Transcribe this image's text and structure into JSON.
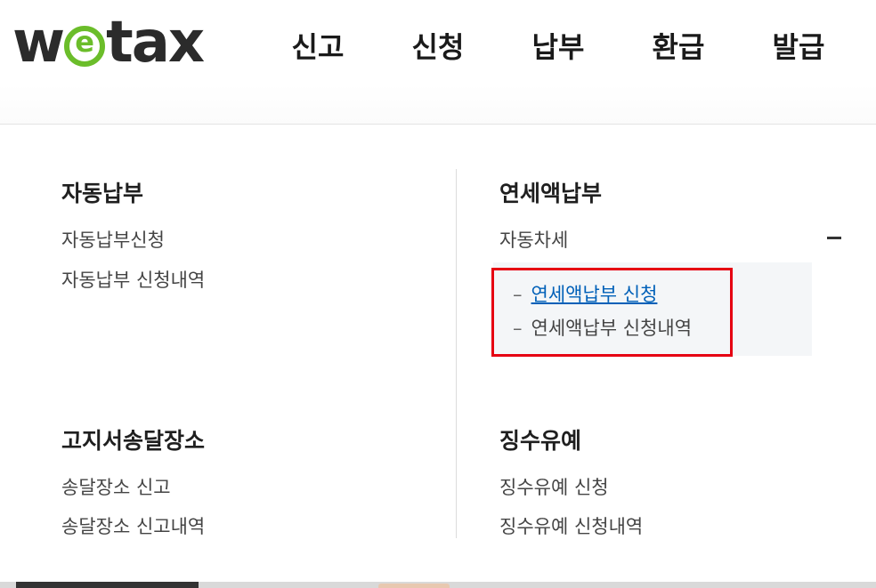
{
  "header": {
    "logo": {
      "prefix": "w",
      "e": "e",
      "suffix": "tax",
      "alt": "wetax"
    },
    "nav": [
      {
        "label": "신고"
      },
      {
        "label": "신청"
      },
      {
        "label": "납부"
      },
      {
        "label": "환급"
      },
      {
        "label": "발급"
      }
    ]
  },
  "menu": {
    "auto_payment": {
      "title": "자동납부",
      "links": [
        "자동납부신청",
        "자동납부 신청내역"
      ]
    },
    "annual_payment": {
      "title": "연세액납부",
      "links": [
        "자동차세"
      ],
      "submenu": [
        "연세액납부 신청",
        "연세액납부 신청내역"
      ],
      "submenu_dash": "–"
    },
    "notice_address": {
      "title": "고지서송달장소",
      "links": [
        "송달장소 신고",
        "송달장소 신고내역"
      ]
    },
    "deferral": {
      "title": "징수유예",
      "links": [
        "징수유예 신청",
        "징수유예 신청내역"
      ]
    }
  },
  "colors": {
    "logo_green": "#6bbd2a",
    "highlight_red": "#e60012",
    "active_link": "#0060b8"
  }
}
